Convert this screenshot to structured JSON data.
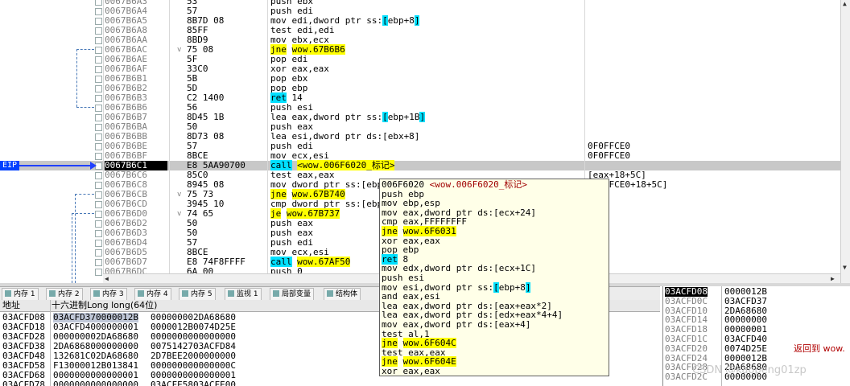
{
  "disasm": {
    "rows": [
      {
        "addr": "0067B6A3",
        "bytes": "53",
        "instr": [
          {
            "t": "push ebx"
          }
        ],
        "cmt": "",
        "arr": ""
      },
      {
        "addr": "0067B6A4",
        "bytes": "57",
        "instr": [
          {
            "t": "push edi"
          }
        ],
        "cmt": "",
        "arr": ""
      },
      {
        "addr": "0067B6A5",
        "bytes": "8B7D 08",
        "instr": [
          {
            "t": "mov edi,dword ptr ss:"
          },
          {
            "t": "[",
            "hl": "c"
          },
          {
            "t": "ebp+8"
          },
          {
            "t": "]",
            "hl": "c"
          }
        ],
        "cmt": "",
        "arr": ""
      },
      {
        "addr": "0067B6A8",
        "bytes": "85FF",
        "instr": [
          {
            "t": "test edi,edi"
          }
        ],
        "cmt": "",
        "arr": ""
      },
      {
        "addr": "0067B6AA",
        "bytes": "8BD9",
        "instr": [
          {
            "t": "mov ebx,ecx"
          }
        ],
        "cmt": "",
        "arr": ""
      },
      {
        "addr": "0067B6AC",
        "bytes": "75 08",
        "instr": [
          {
            "t": "jne",
            "hl": "y"
          },
          {
            "t": " "
          },
          {
            "t": "wow.67B6B6",
            "hl": "y"
          }
        ],
        "cmt": "",
        "arr": "v"
      },
      {
        "addr": "0067B6AE",
        "bytes": "5F",
        "instr": [
          {
            "t": "pop edi"
          }
        ],
        "cmt": "",
        "arr": ""
      },
      {
        "addr": "0067B6AF",
        "bytes": "33C0",
        "instr": [
          {
            "t": "xor eax,eax"
          }
        ],
        "cmt": "",
        "arr": ""
      },
      {
        "addr": "0067B6B1",
        "bytes": "5B",
        "instr": [
          {
            "t": "pop ebx"
          }
        ],
        "cmt": "",
        "arr": ""
      },
      {
        "addr": "0067B6B2",
        "bytes": "5D",
        "instr": [
          {
            "t": "pop ebp"
          }
        ],
        "cmt": "",
        "arr": ""
      },
      {
        "addr": "0067B6B3",
        "bytes": "C2 1400",
        "instr": [
          {
            "t": "ret",
            "hl": "c"
          },
          {
            "t": " 14"
          }
        ],
        "cmt": "",
        "arr": ""
      },
      {
        "addr": "0067B6B6",
        "bytes": "56",
        "instr": [
          {
            "t": "push esi"
          }
        ],
        "cmt": "",
        "arr": ""
      },
      {
        "addr": "0067B6B7",
        "bytes": "8D45 1B",
        "instr": [
          {
            "t": "lea eax,dword ptr ss:"
          },
          {
            "t": "[",
            "hl": "c"
          },
          {
            "t": "ebp+1B"
          },
          {
            "t": "]",
            "hl": "c"
          }
        ],
        "cmt": "",
        "arr": ""
      },
      {
        "addr": "0067B6BA",
        "bytes": "50",
        "instr": [
          {
            "t": "push eax"
          }
        ],
        "cmt": "",
        "arr": ""
      },
      {
        "addr": "0067B6BB",
        "bytes": "8D73 08",
        "instr": [
          {
            "t": "lea esi,dword ptr ds:[ebx+8]"
          }
        ],
        "cmt": "",
        "arr": ""
      },
      {
        "addr": "0067B6BE",
        "bytes": "57",
        "instr": [
          {
            "t": "push edi"
          }
        ],
        "cmt": "0F0FFCE0",
        "arr": ""
      },
      {
        "addr": "0067B6BF",
        "bytes": "8BCE",
        "instr": [
          {
            "t": "mov ecx,esi"
          }
        ],
        "cmt": "0F0FFCE0",
        "arr": ""
      },
      {
        "addr": "0067B6C1",
        "bytes": "E8 5AA90700",
        "instr": [
          {
            "t": "call",
            "hl": "c"
          },
          {
            "t": " "
          },
          {
            "t": "<wow.006F6020_标记>",
            "hl": "y"
          }
        ],
        "cmt": "",
        "arr": "",
        "eip": true
      },
      {
        "addr": "0067B6C6",
        "bytes": "85C0",
        "instr": [
          {
            "t": "test eax,eax"
          }
        ],
        "cmt": "[eax+18+5C]",
        "arr": ""
      },
      {
        "addr": "0067B6C8",
        "bytes": "8945 08",
        "instr": [
          {
            "t": "mov dword ptr ss:[ebp+8],eax"
          }
        ],
        "cmt": "0F0FFCE0+18+5C]",
        "arr": ""
      },
      {
        "addr": "0067B6CB",
        "bytes": "75 73",
        "instr": [
          {
            "t": "jne",
            "hl": "y"
          },
          {
            "t": " "
          },
          {
            "t": "wow.67B740",
            "hl": "y"
          }
        ],
        "cmt": "",
        "arr": "v"
      },
      {
        "addr": "0067B6CD",
        "bytes": "3945 10",
        "instr": [
          {
            "t": "cmp dword ptr ss:[ebp+10],eax"
          }
        ],
        "cmt": "",
        "arr": ""
      },
      {
        "addr": "0067B6D0",
        "bytes": "74 65",
        "instr": [
          {
            "t": "je",
            "hl": "y"
          },
          {
            "t": " "
          },
          {
            "t": "wow.67B737",
            "hl": "y"
          }
        ],
        "cmt": "",
        "arr": "v"
      },
      {
        "addr": "0067B6D2",
        "bytes": "50",
        "instr": [
          {
            "t": "push eax"
          }
        ],
        "cmt": "",
        "arr": ""
      },
      {
        "addr": "0067B6D3",
        "bytes": "50",
        "instr": [
          {
            "t": "push eax"
          }
        ],
        "cmt": "",
        "arr": ""
      },
      {
        "addr": "0067B6D4",
        "bytes": "57",
        "instr": [
          {
            "t": "push edi"
          }
        ],
        "cmt": "",
        "arr": ""
      },
      {
        "addr": "0067B6D5",
        "bytes": "8BCE",
        "instr": [
          {
            "t": "mov ecx,esi"
          }
        ],
        "cmt": "",
        "arr": ""
      },
      {
        "addr": "0067B6D7",
        "bytes": "E8 74F8FFFF",
        "instr": [
          {
            "t": "call",
            "hl": "c"
          },
          {
            "t": " "
          },
          {
            "t": "wow.67AF50",
            "hl": "y"
          }
        ],
        "cmt": "",
        "arr": ""
      },
      {
        "addr": "0067B6DC",
        "bytes": "6A 00",
        "instr": [
          {
            "t": "push 0"
          }
        ],
        "cmt": "",
        "arr": ""
      }
    ],
    "eip_label": "EIP"
  },
  "tooltip": {
    "rows": [
      [
        {
          "t": "006F6020 "
        },
        {
          "t": "<wow.006F6020_标记>",
          "c": "title"
        }
      ],
      [
        {
          "t": "push ebp"
        }
      ],
      [
        {
          "t": "mov ebp,esp"
        }
      ],
      [
        {
          "t": "mov eax,dword ptr ds:[ecx+24]"
        }
      ],
      [
        {
          "t": "cmp eax,FFFFFFFF"
        }
      ],
      [
        {
          "t": "jne",
          "hl": "y"
        },
        {
          "t": " "
        },
        {
          "t": "wow.6F6031",
          "hl": "y"
        }
      ],
      [
        {
          "t": "xor eax,eax"
        }
      ],
      [
        {
          "t": "pop ebp"
        }
      ],
      [
        {
          "t": "ret",
          "hl": "c"
        },
        {
          "t": " 8"
        }
      ],
      [
        {
          "t": "mov edx,dword ptr ds:[ecx+1C]"
        }
      ],
      [
        {
          "t": "push esi"
        }
      ],
      [
        {
          "t": "mov esi,dword ptr ss:"
        },
        {
          "t": "[",
          "hl": "c"
        },
        {
          "t": "ebp+8"
        },
        {
          "t": "]",
          "hl": "c"
        }
      ],
      [
        {
          "t": "and eax,esi"
        }
      ],
      [
        {
          "t": "lea eax,dword ptr ds:[eax+eax*2]"
        }
      ],
      [
        {
          "t": "lea eax,dword ptr ds:[edx+eax*4+4]"
        }
      ],
      [
        {
          "t": "mov eax,dword ptr ds:[eax+4]"
        }
      ],
      [
        {
          "t": "test al,1"
        }
      ],
      [
        {
          "t": "jne",
          "hl": "y"
        },
        {
          "t": " "
        },
        {
          "t": "wow.6F604C",
          "hl": "y"
        }
      ],
      [
        {
          "t": "test eax,eax"
        }
      ],
      [
        {
          "t": "jne",
          "hl": "y"
        },
        {
          "t": " "
        },
        {
          "t": "wow.6F604E",
          "hl": "y"
        }
      ],
      [
        {
          "t": "xor eax,eax"
        }
      ]
    ]
  },
  "tabs": [
    {
      "label": "内存 1",
      "icon": "memory-icon"
    },
    {
      "label": "内存 2",
      "icon": "memory-icon"
    },
    {
      "label": "内存 3",
      "icon": "memory-icon"
    },
    {
      "label": "内存 4",
      "icon": "memory-icon"
    },
    {
      "label": "内存 5",
      "icon": "memory-icon"
    },
    {
      "label": "监视 1",
      "icon": "watch-icon"
    },
    {
      "label": "局部变量",
      "icon": "locals-icon"
    },
    {
      "label": "结构体",
      "icon": "struct-icon"
    }
  ],
  "dump": {
    "header_addr": "地址",
    "header_hex": "十六进制Long long(64位)",
    "rows": [
      {
        "addr": "03ACFD08",
        "c1": "03ACFD370000012B",
        "c2": "000000002DA68680"
      },
      {
        "addr": "03ACFD18",
        "c1": "03ACFD4000000001",
        "c2": "0000012B0074D25E"
      },
      {
        "addr": "03ACFD28",
        "c1": "000000002DA68680",
        "c2": "0000000000000000"
      },
      {
        "addr": "03ACFD38",
        "c1": "2DA6868000000000",
        "c2": "0075142703ACFD84"
      },
      {
        "addr": "03ACFD48",
        "c1": "132681C02DA68680",
        "c2": "2D7BEE2000000000"
      },
      {
        "addr": "03ACFD58",
        "c1": "F13000012B013841",
        "c2": "000000000000000C"
      },
      {
        "addr": "03ACFD68",
        "c1": "0000000000000001",
        "c2": "0000000000000001"
      },
      {
        "addr": "03ACFD78",
        "c1": "0000000000000000",
        "c2": "03ACFE5803ACFE00"
      }
    ]
  },
  "stack": {
    "rows": [
      {
        "addr": "03ACFD08",
        "val": "0000012B",
        "cmt": ""
      },
      {
        "addr": "03ACFD0C",
        "val": "03ACFD37",
        "cmt": ""
      },
      {
        "addr": "03ACFD10",
        "val": "2DA68680",
        "cmt": ""
      },
      {
        "addr": "03ACFD14",
        "val": "00000000",
        "cmt": ""
      },
      {
        "addr": "03ACFD18",
        "val": "00000001",
        "cmt": ""
      },
      {
        "addr": "03ACFD1C",
        "val": "03ACFD40",
        "cmt": ""
      },
      {
        "addr": "03ACFD20",
        "val": "0074D25E",
        "cmt": "返回到 wow."
      },
      {
        "addr": "03ACFD24",
        "val": "0000012B",
        "cmt": ""
      },
      {
        "addr": "03ACFD28",
        "val": "2DA68680",
        "cmt": ""
      },
      {
        "addr": "03ACFD2C",
        "val": "00000000",
        "cmt": ""
      }
    ]
  },
  "watermark": "CSDN @kaopeng01zp"
}
